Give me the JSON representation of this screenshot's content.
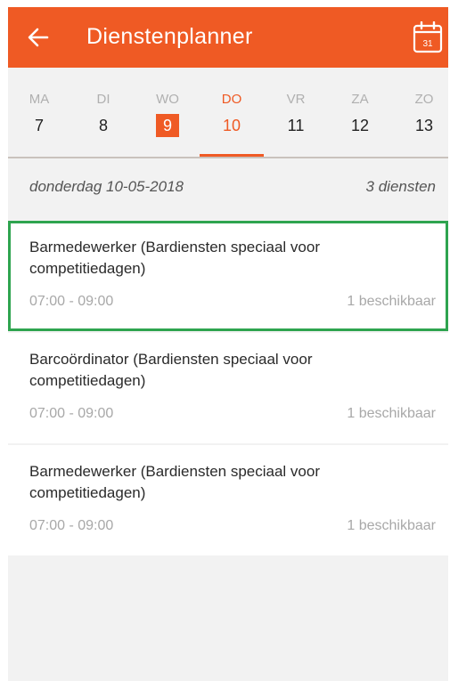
{
  "header": {
    "title": "Dienstenplanner",
    "back_icon": "arrow-left-icon",
    "calendar_icon": "calendar-icon",
    "calendar_day": "31",
    "color": "#ef5a24"
  },
  "week": {
    "days": [
      {
        "dow": "MA",
        "num": "7"
      },
      {
        "dow": "DI",
        "num": "8"
      },
      {
        "dow": "WO",
        "num": "9"
      },
      {
        "dow": "DO",
        "num": "10"
      },
      {
        "dow": "VR",
        "num": "11"
      },
      {
        "dow": "ZA",
        "num": "12"
      },
      {
        "dow": "ZO",
        "num": "13"
      }
    ],
    "today": "9",
    "selected": "10"
  },
  "summary": {
    "date": "donderdag 10-05-2018",
    "count": "3 diensten"
  },
  "shifts": [
    {
      "name": "Barmedewerker (Bardiensten speciaal voor competitiedagen)",
      "time": "07:00 - 09:00",
      "availability": "1 beschikbaar"
    },
    {
      "name": "Barcoördinator (Bardiensten speciaal voor competitiedagen)",
      "time": "07:00 - 09:00",
      "availability": "1 beschikbaar"
    },
    {
      "name": "Barmedewerker (Bardiensten speciaal voor competitiedagen)",
      "time": "07:00 - 09:00",
      "availability": "1 beschikbaar"
    }
  ]
}
